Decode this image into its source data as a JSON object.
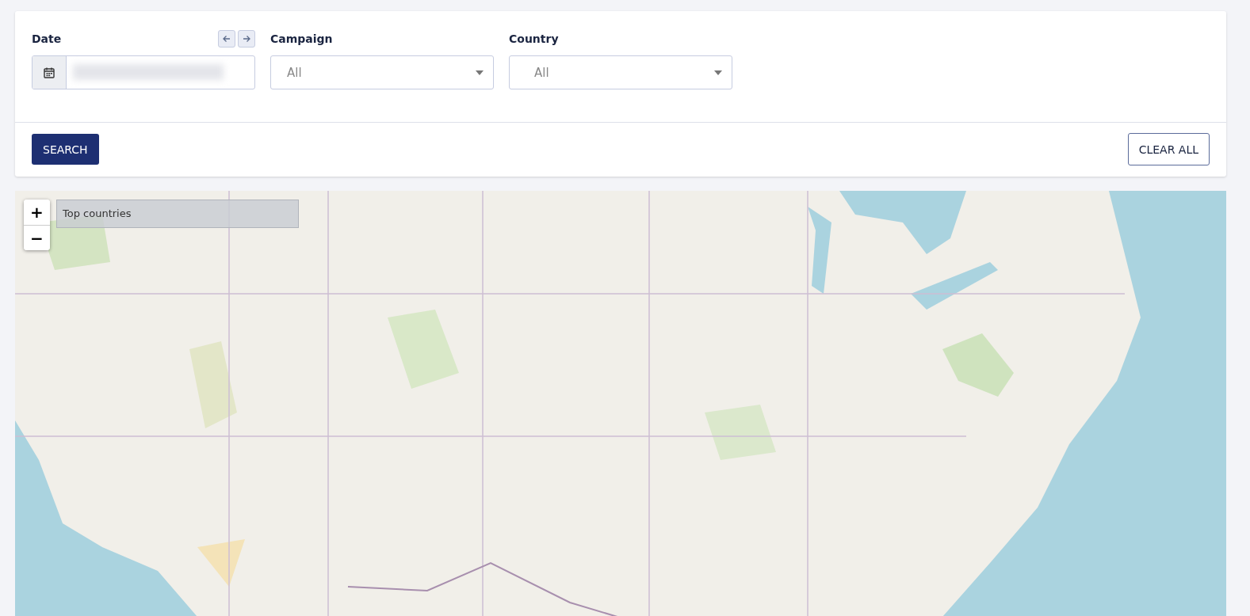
{
  "filters": [
    {
      "kind": "date",
      "label": "Date"
    },
    {
      "kind": "select",
      "label": "Campaign",
      "placeholder": "All"
    },
    {
      "kind": "select",
      "label": "Country",
      "placeholder": "All"
    }
  ],
  "actions": {
    "search": "SEARCH",
    "clear": "CLEAR ALL"
  },
  "map": {
    "kind": "picture",
    "zoom_in": "+",
    "zoom_out": "−",
    "legend": "Top countries"
  }
}
